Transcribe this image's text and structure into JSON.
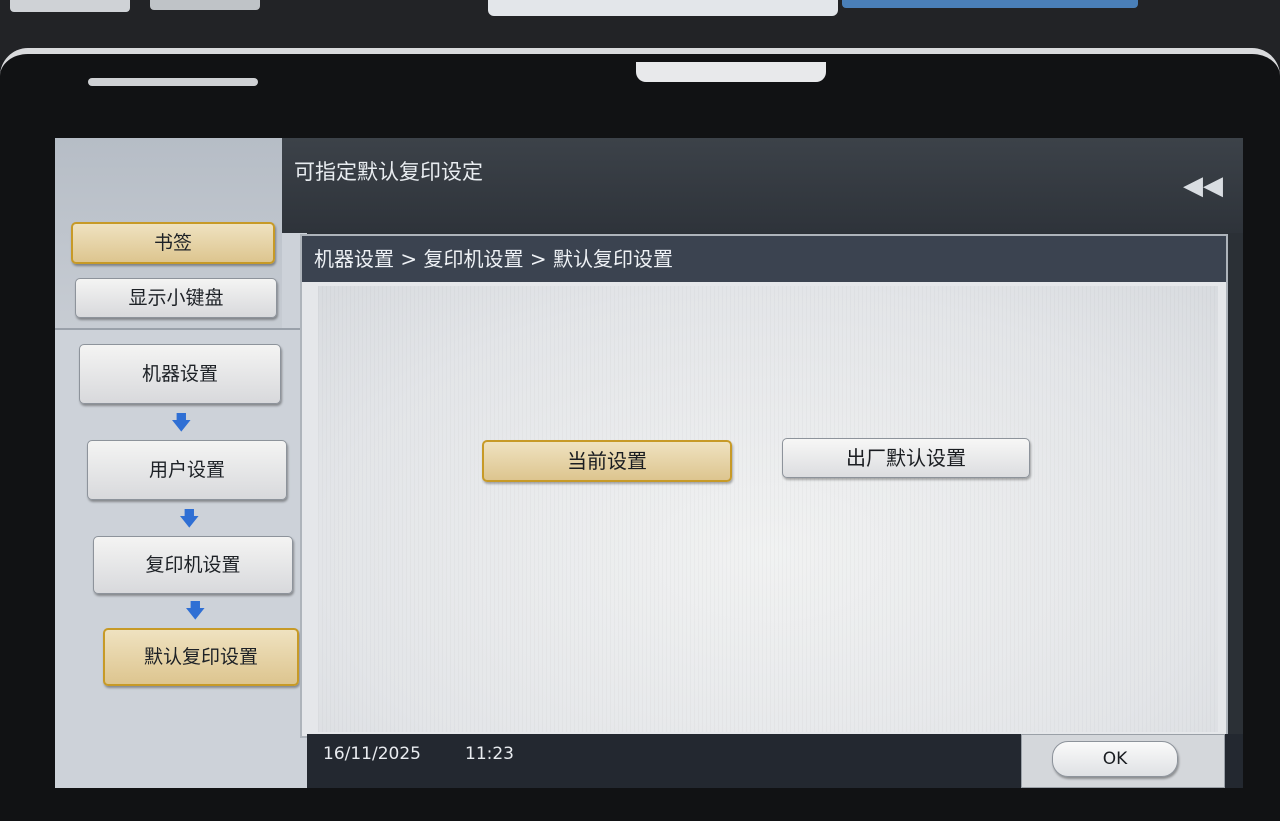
{
  "screen": {
    "title": "可指定默认复印设定",
    "back_icon": "double-left-arrow-icon"
  },
  "sidebar": {
    "bookmark_label": "书签",
    "keypad_label": "显示小键盘",
    "nav_items": [
      {
        "label": "机器设置"
      },
      {
        "label": "用户设置"
      },
      {
        "label": "复印机设置"
      },
      {
        "label": "默认复印设置"
      }
    ],
    "arrow_icon": "arrow-down-icon"
  },
  "breadcrumb": "机器设置 > 复印机设置 > 默认复印设置",
  "options": {
    "current_label": "当前设置",
    "factory_label": "出厂默认设置"
  },
  "status": {
    "date": "16/11/2025",
    "time": "11:23"
  },
  "ok_label": "OK",
  "colors": {
    "accent_gold": "#c79a27",
    "arrow_blue": "#2f6fd4",
    "header_dark": "#3b4350"
  }
}
